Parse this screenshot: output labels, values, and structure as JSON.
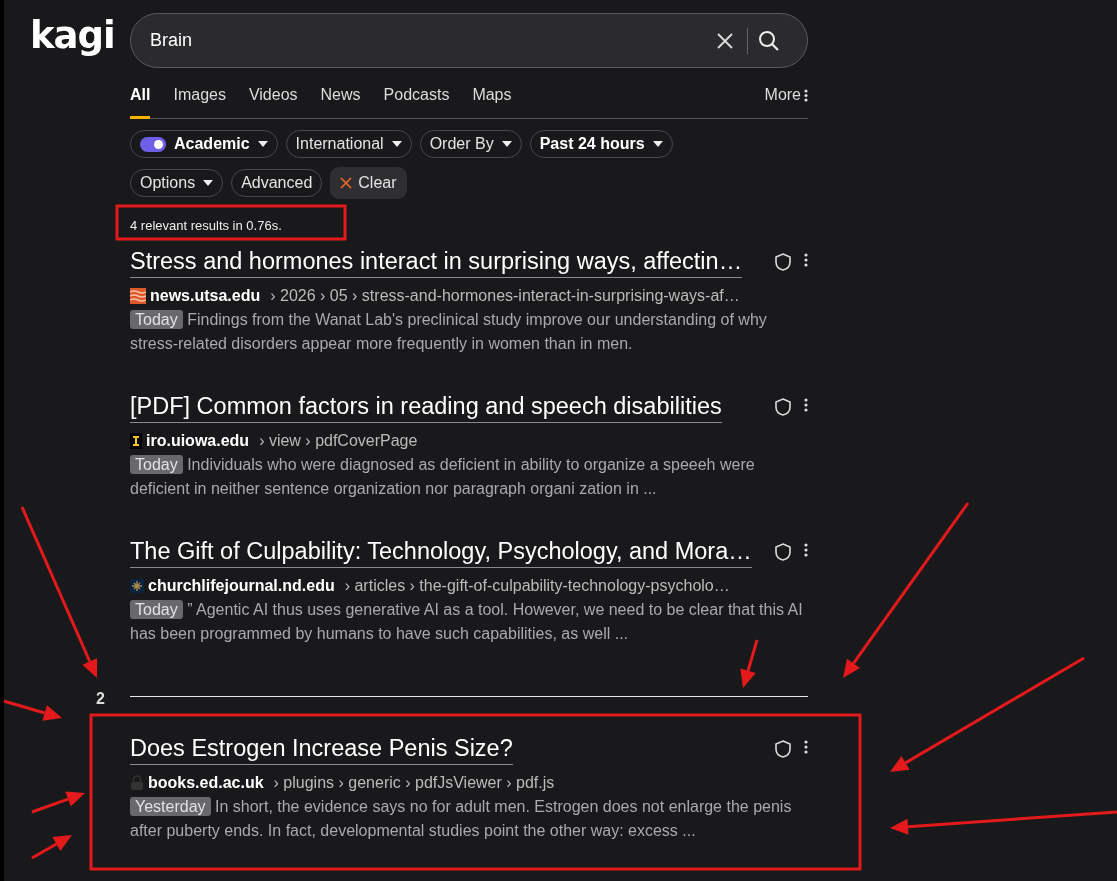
{
  "logo": "kagi",
  "search": {
    "value": "Brain"
  },
  "tabs": [
    {
      "label": "All",
      "selected": true
    },
    {
      "label": "Images",
      "selected": false
    },
    {
      "label": "Videos",
      "selected": false
    },
    {
      "label": "News",
      "selected": false
    },
    {
      "label": "Podcasts",
      "selected": false
    },
    {
      "label": "Maps",
      "selected": false
    }
  ],
  "more": "More",
  "filter_rows": [
    [
      {
        "kind": "toggle",
        "label": "Academic",
        "on": true,
        "active": true
      },
      {
        "kind": "dropdown",
        "label": "International",
        "active": false
      },
      {
        "kind": "dropdown",
        "label": "Order By",
        "active": false
      },
      {
        "kind": "dropdown",
        "label": "Past 24 hours",
        "active": true
      }
    ],
    [
      {
        "kind": "dropdown",
        "label": "Options",
        "active": false
      },
      {
        "kind": "button",
        "label": "Advanced",
        "active": false
      },
      {
        "kind": "clear",
        "label": "Clear",
        "active": false
      }
    ]
  ],
  "result_count": "4 relevant results in 0.76s.",
  "results": [
    {
      "title": "Stress and hormones interact in surprising ways, affectin…",
      "domain": "news.utsa.edu",
      "path": "› 2026 › 05 › stress-and-hormones-interact-in-surprising-ways-af…",
      "date": "Today",
      "snippet": "Findings from the Wanat Lab's preclinical study improve our understanding of why stress-related disorders appear more frequently in women than in men."
    },
    {
      "title": "[PDF] Common factors in reading and speech disabilities",
      "domain": "iro.uiowa.edu",
      "path": "› view › pdfCoverPage",
      "date": "Today",
      "snippet": "Individuals who were diagnosed as deficient in ability to organize a speeeh were deficient in neither sentence organization nor paragraph organi zation in ..."
    },
    {
      "title": "The Gift of Culpability: Technology, Psychology, and Mora…",
      "domain": "churchlifejournal.nd.edu",
      "path": "› articles › the-gift-of-culpability-technology-psycholo…",
      "date": "Today",
      "snippet": "” Agentic AI thus uses generative AI as a tool. However, we need to be clear that this AI has been programmed by humans to have such capabilities, as well ..."
    }
  ],
  "page_separator": "2",
  "results_page_2": [
    {
      "title": "Does Estrogen Increase Penis Size?",
      "domain": "books.ed.ac.uk",
      "path": "› plugins › generic › pdfJsViewer › pdf.js",
      "date": "Yesterday",
      "snippet": "In short, the evidence says no for adult men. Estrogen does not enlarge the penis after puberty ends. In fact, developmental studies point the other way: excess ..."
    }
  ]
}
